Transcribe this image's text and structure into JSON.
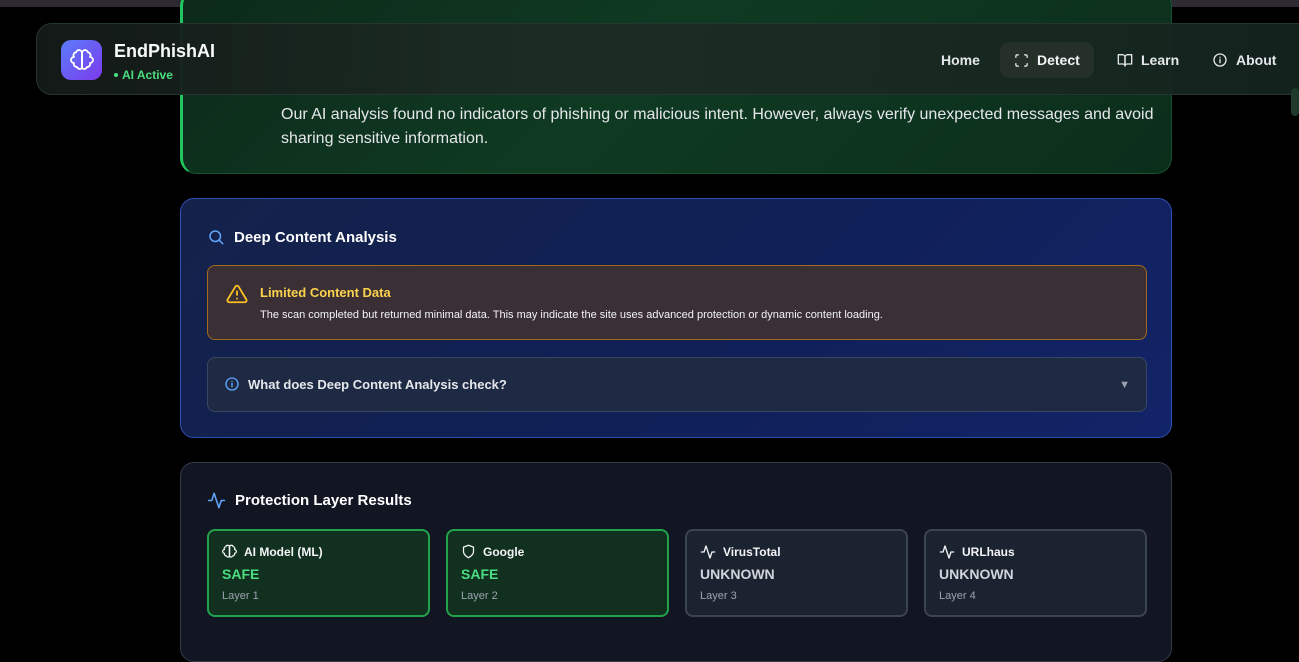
{
  "brand": {
    "name": "EndPhishAI",
    "status": "AI Active",
    "logo_icon": "brain-icon"
  },
  "nav": {
    "items": [
      {
        "label": "Home",
        "icon": ""
      },
      {
        "label": "Detect",
        "icon": "scan-icon",
        "active": true
      },
      {
        "label": "Learn",
        "icon": "book-icon"
      },
      {
        "label": "About",
        "icon": "info-icon"
      }
    ]
  },
  "result": {
    "message": "Our AI analysis found no indicators of phishing or malicious intent. However, always verify unexpected messages and avoid sharing sensitive information."
  },
  "deep_analysis": {
    "title": "Deep Content Analysis",
    "warning": {
      "title": "Limited Content Data",
      "text": "The scan completed but returned minimal data. This may indicate the site uses advanced protection or dynamic content loading."
    },
    "faq": {
      "label": "What does Deep Content Analysis check?"
    }
  },
  "protection": {
    "title": "Protection Layer Results",
    "layers": [
      {
        "name": "AI Model (ML)",
        "status": "SAFE",
        "sub": "Layer 1",
        "icon": "brain-icon"
      },
      {
        "name": "Google",
        "status": "SAFE",
        "sub": "Layer 2",
        "icon": "shield-icon"
      },
      {
        "name": "VirusTotal",
        "status": "UNKNOWN",
        "sub": "Layer 3",
        "icon": "activity-icon"
      },
      {
        "name": "URLhaus",
        "status": "UNKNOWN",
        "sub": "Layer 4",
        "icon": "activity-icon"
      }
    ]
  },
  "colors": {
    "safe": "#4ade80",
    "accent_blue": "#2f4fb0",
    "warning": "#fcd34d"
  }
}
